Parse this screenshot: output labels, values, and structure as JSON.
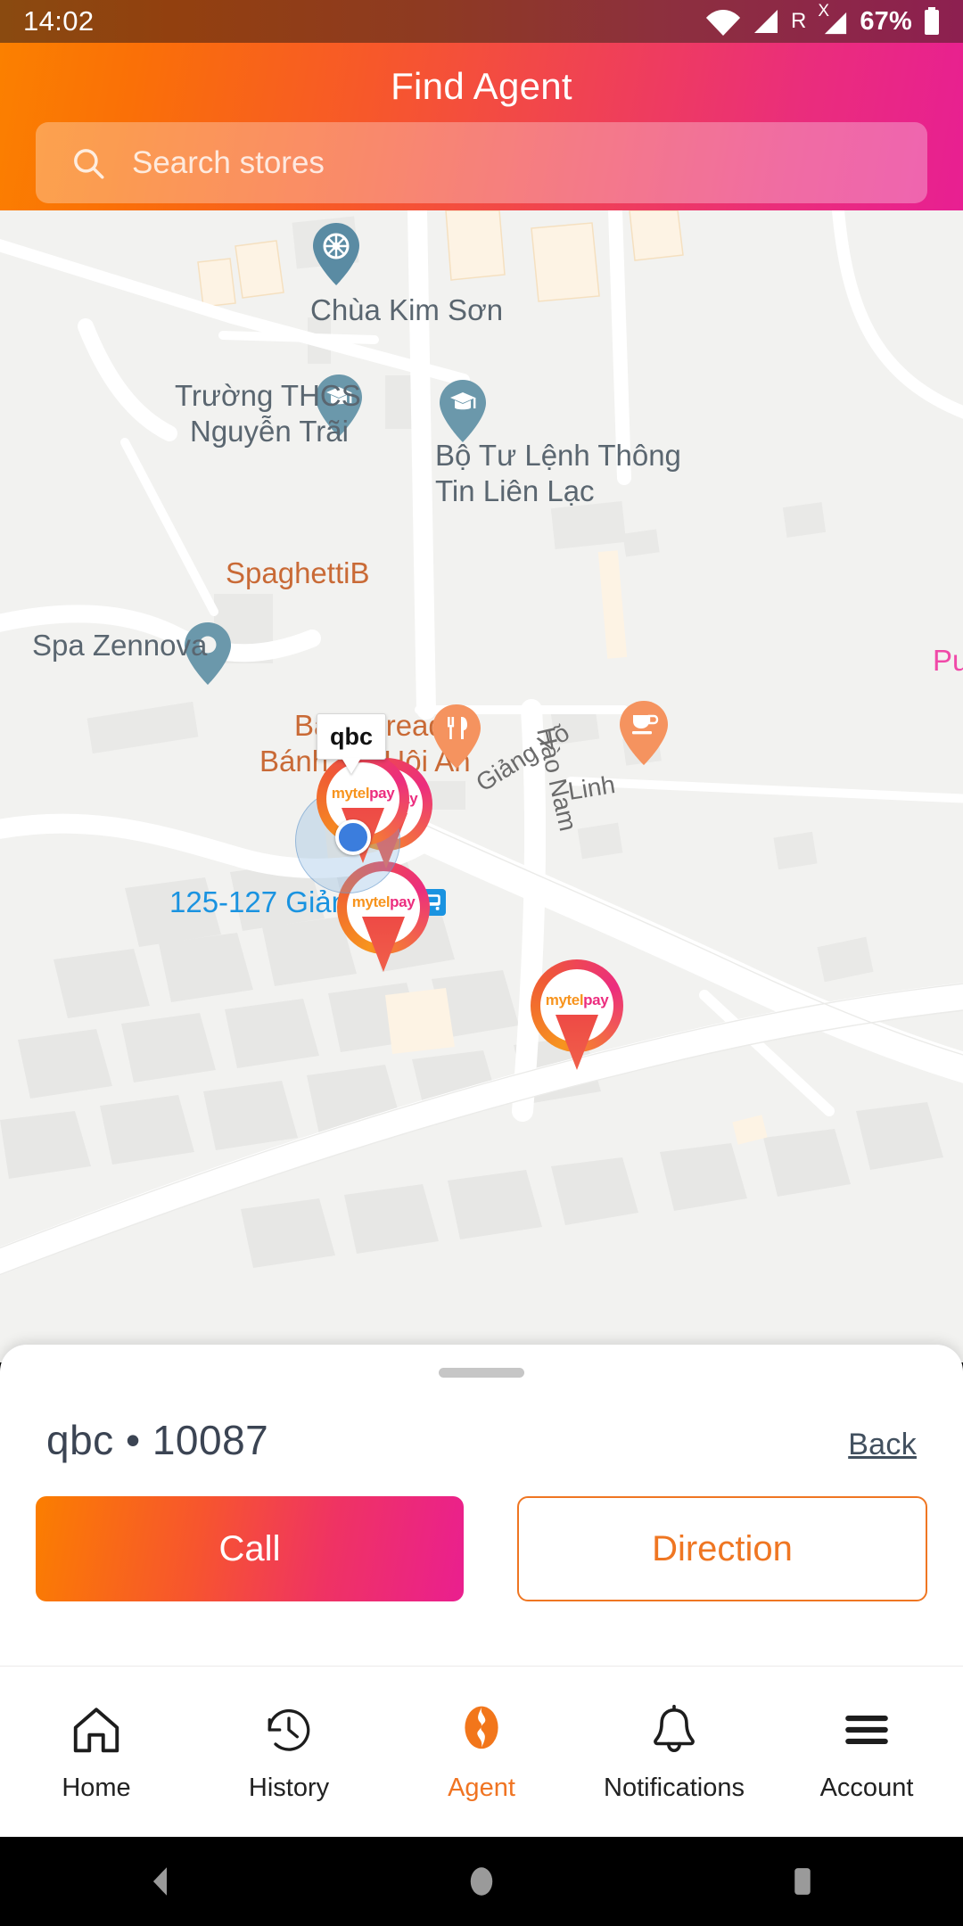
{
  "status_bar": {
    "time": "14:02",
    "roaming": "R",
    "sim_x": "X",
    "battery": "67%",
    "icons": [
      "wifi-icon",
      "signal-icon",
      "roaming-indicator",
      "signal-x-icon",
      "battery-icon"
    ]
  },
  "header": {
    "title": "Find Agent",
    "gradient_start": "#fb8000",
    "gradient_end": "#e81f92"
  },
  "search": {
    "placeholder": "Search stores",
    "value": "",
    "icon": "search-icon"
  },
  "map": {
    "selected_marker_label": "qbc",
    "labels": [
      {
        "text": "Chùa Kim Sơn",
        "kind": "poi"
      },
      {
        "text": "Trường THCS",
        "kind": "poi"
      },
      {
        "text": "Nguyễn Trãi",
        "kind": "poi"
      },
      {
        "text": "Bộ Tư Lệnh Thông",
        "kind": "poi"
      },
      {
        "text": "Tin Liên Lạc",
        "kind": "poi"
      },
      {
        "text": "SpaghettiB",
        "kind": "poi-orange"
      },
      {
        "text": "Spa Zennova",
        "kind": "poi"
      },
      {
        "text": "Bami bread -",
        "kind": "poi-orange"
      },
      {
        "text": "Bánh mỳ Hội An",
        "kind": "poi-orange"
      },
      {
        "text": "Pu",
        "kind": "poi-pink"
      },
      {
        "text": "Linh",
        "kind": "street"
      },
      {
        "text": "125-127 Giảng Võ",
        "kind": "transit"
      }
    ],
    "streets": [
      "Giảng Võ",
      "Hào Nam"
    ],
    "agent_brand": "mytelpay",
    "agent_brand_a": "mytel",
    "agent_brand_b": "pay",
    "locate_button": "locate-me-icon",
    "user_location": "blue-dot"
  },
  "sheet": {
    "title": "qbc •  10087",
    "back_label": "Back",
    "call_label": "Call",
    "direction_label": "Direction"
  },
  "tabs": [
    {
      "label": "Home",
      "icon": "home-icon",
      "active": false
    },
    {
      "label": "History",
      "icon": "history-clock-icon",
      "active": false
    },
    {
      "label": "Agent",
      "icon": "agent-map-icon",
      "active": true
    },
    {
      "label": "Notifications",
      "icon": "bell-icon",
      "active": false
    },
    {
      "label": "Account",
      "icon": "hamburger-menu-icon",
      "active": false
    }
  ],
  "android_nav": {
    "back": "back-triangle-icon",
    "home": "home-circle-icon",
    "recents": "recents-square-icon"
  },
  "colors": {
    "accent_orange": "#f07422",
    "accent_pink": "#ea1f8f",
    "map_bg": "#f2f2f0",
    "transit_blue": "#1a93e0"
  }
}
